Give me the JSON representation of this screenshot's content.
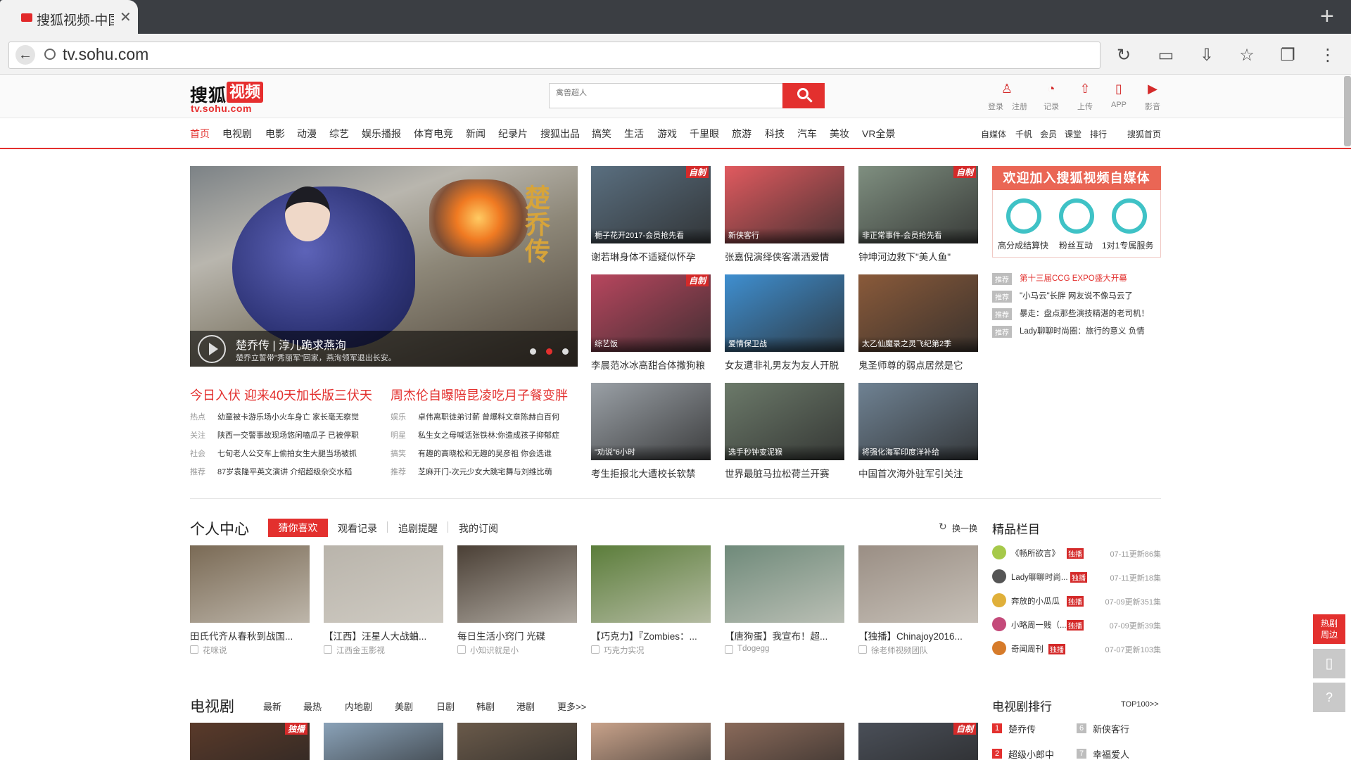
{
  "browser": {
    "tab_title": "搜狐视频-中国",
    "url": "tv.sohu.com"
  },
  "header": {
    "logo_text": "搜狐",
    "logo_box": "视频",
    "logo_domain": "tv.sohu.com",
    "search_placeholder": "禽兽超人",
    "tools": [
      {
        "label": "登录",
        "icon": "user-icon"
      },
      {
        "label": "注册",
        "icon": ""
      },
      {
        "label": "记录",
        "icon": "history-icon"
      },
      {
        "label": "上传",
        "icon": "upload-icon"
      },
      {
        "label": "APP",
        "icon": "phone-icon"
      },
      {
        "label": "影音",
        "icon": "player-icon"
      }
    ]
  },
  "nav": {
    "items": [
      "首页",
      "电视剧",
      "电影",
      "动漫",
      "综艺",
      "娱乐播报",
      "体育电竞",
      "新闻",
      "纪录片",
      "搜狐出品",
      "搞笑",
      "生活",
      "游戏",
      "千里眼",
      "旅游",
      "科技",
      "汽车",
      "美妆",
      "VR全景"
    ],
    "right": [
      "自媒体",
      "千帆",
      "会员",
      "课堂",
      "排行",
      "搜狐首页"
    ]
  },
  "hero": {
    "calligraphy": "楚乔传",
    "title": "楚乔传 | 淳儿跪求燕洵",
    "subtitle": "楚乔立誓带\"秀丽军\"回家，燕洵领军退出长安。"
  },
  "headlines": [
    "今日入伏 迎来40天加长版三伏天",
    "周杰伦自曝陪昆凌吃月子餐变胖"
  ],
  "news_left": [
    {
      "tag": "热点",
      "text": "幼童被卡游乐场小火车身亡 家长毫无察觉"
    },
    {
      "tag": "关注",
      "text": "陕西一交警事故现场悠闲嗑瓜子 已被停职"
    },
    {
      "tag": "社会",
      "text": "七旬老人公交车上偷拍女生大腿当场被抓"
    },
    {
      "tag": "推荐",
      "text": "87岁袁隆平英文演讲 介绍超级杂交水稻"
    }
  ],
  "news_right": [
    {
      "tag": "娱乐",
      "text": "卓伟离职徒弟讨薪 曾爆料文章陈赫白百何"
    },
    {
      "tag": "明星",
      "text": "私生女之母喊话张铁林:你造成孩子抑郁症"
    },
    {
      "tag": "搞笑",
      "text": "有趣的高晓松和无趣的吴彦祖 你会选谁"
    },
    {
      "tag": "推荐",
      "text": "芝麻开门-次元少女大跳宅舞与刘维比萌"
    }
  ],
  "grid": [
    {
      "cap": "梔子花开2017-会员抢先看",
      "title": "谢若琳身体不适疑似怀孕",
      "badge": "自制",
      "color": "#5a6f80"
    },
    {
      "cap": "新侠客行",
      "title": "张嘉倪演绎侠客潇洒爱情",
      "badge": "",
      "color": "#e15a5f"
    },
    {
      "cap": "非正常事件-会员抢先看",
      "title": "钟坤河边救下\"美人鱼\"",
      "badge": "自制",
      "color": "#7f8f80"
    },
    {
      "cap": "综艺饭",
      "title": "李晨范冰冰高甜合体撒狗粮",
      "badge": "自制",
      "color": "#b8465e"
    },
    {
      "cap": "爱情保卫战",
      "title": "女友遭非礼男友为友人开脱",
      "badge": "",
      "color": "#3f8fd0"
    },
    {
      "cap": "太乙仙魔录之灵飞纪第2季",
      "title": "鬼圣师尊的弱点居然是它",
      "badge": "",
      "color": "#8a5a3a"
    },
    {
      "cap": "\"劝说\"6小时",
      "title": "考生拒报北大遭校长软禁",
      "badge": "",
      "color": "#9aa0a6"
    },
    {
      "cap": "选手秒钟变泥猴",
      "title": "世界最脏马拉松荷兰开赛",
      "badge": "",
      "color": "#6c7a6a"
    },
    {
      "cap": "将强化海军印度洋补给",
      "title": "中国首次海外驻军引关注",
      "badge": "",
      "color": "#6f8293"
    }
  ],
  "promo": {
    "banner": "欢迎加入搜狐视频自媒体",
    "items": [
      "高分成结算快",
      "粉丝互动",
      "1对1专属服务"
    ]
  },
  "recommend": [
    {
      "tag": "推荐",
      "text": "第十三届CCG EXPO盛大开幕",
      "highlight": true
    },
    {
      "tag": "推荐",
      "text": "\"小马云\"长胖 网友说不像马云了",
      "highlight": false
    },
    {
      "tag": "推荐",
      "text": "暴走：盘点那些演技精湛的老司机！",
      "highlight": false
    },
    {
      "tag": "推荐",
      "text": "Lady聊聊时尚圈：旅行的意义 负情",
      "highlight": false
    }
  ],
  "personal": {
    "title": "个人中心",
    "tabs": [
      "猜你喜欢",
      "观看记录",
      "追剧提醒",
      "我的订阅"
    ],
    "refresh": "换一换",
    "items": [
      {
        "title": "田氏代齐从春秋到战国...",
        "src": "花咪说",
        "color": "#7a6a55"
      },
      {
        "title": "【江西】汪星人大战蛐...",
        "src": "江西金玉影视",
        "color": "#b9b4ab"
      },
      {
        "title": "每日生活小窍门 光碟",
        "src": "小知识就是小",
        "color": "#4a3f35"
      },
      {
        "title": "【巧克力】『Zombies：...",
        "src": "巧克力实况",
        "color": "#5b7d3a"
      },
      {
        "title": "【唐狗蛋】我宣布！超...",
        "src": "Tdogegg",
        "color": "#6f8a7a"
      },
      {
        "title": "【独播】Chinajoy2016...",
        "src": "徐老师视频团队",
        "color": "#9a8e84"
      }
    ]
  },
  "featured": {
    "title": "精品栏目",
    "badge": "独播",
    "items": [
      {
        "name": "《畅所欲言》",
        "date": "07-11更新86集"
      },
      {
        "name": "Lady聊聊时尚...",
        "date": "07-11更新18集"
      },
      {
        "name": "奔放的小瓜瓜",
        "date": "07-09更新351集"
      },
      {
        "name": "小略周一贱（...",
        "date": "07-09更新39集"
      },
      {
        "name": "奇闻周刊",
        "date": "07-07更新103集"
      }
    ]
  },
  "tv": {
    "title": "电视剧",
    "tabs": [
      "最新",
      "最热",
      "内地剧",
      "美剧",
      "日剧",
      "韩剧",
      "港剧",
      "更多>>"
    ],
    "rank_title": "电视剧排行",
    "rank_more": "TOP100>>",
    "rank": [
      {
        "n": "1",
        "name": "楚乔传"
      },
      {
        "n": "2",
        "name": "超级小郎中"
      },
      {
        "n": "6",
        "name": "新侠客行"
      },
      {
        "n": "7",
        "name": "幸福爱人"
      }
    ],
    "thumb_badges": [
      "独播",
      "自制"
    ]
  },
  "floats": {
    "hot": "热剧\n周边"
  }
}
